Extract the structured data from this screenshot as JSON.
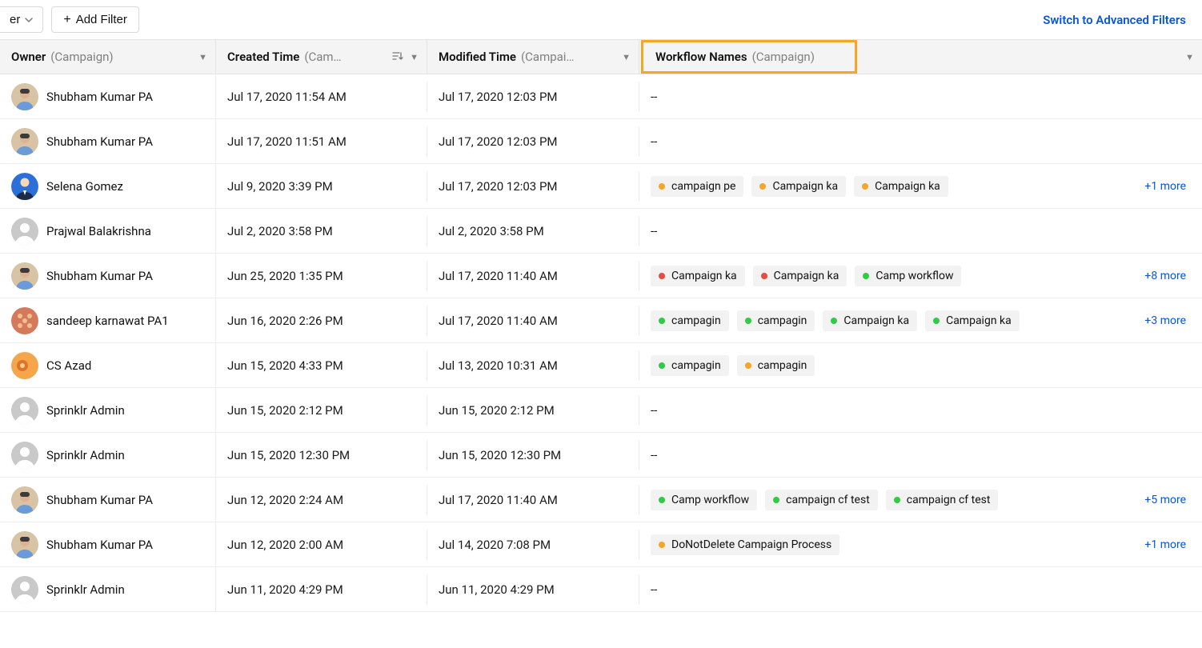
{
  "toolbar": {
    "dropdown_truncated": "er",
    "add_filter_label": "Add Filter",
    "switch_link": "Switch to Advanced Filters"
  },
  "columns": {
    "owner": {
      "main": "Owner",
      "sub": "(Campaign)"
    },
    "created": {
      "main": "Created Time",
      "sub": "(Cam…"
    },
    "modified": {
      "main": "Modified Time",
      "sub": "(Campai…"
    },
    "workflow": {
      "main": "Workflow Names",
      "sub": "(Campaign)"
    }
  },
  "avatar_types": {
    "photo1": "photo1",
    "suit": "suit",
    "default": "default",
    "pattern": "pattern",
    "orange": "orange"
  },
  "rows": [
    {
      "owner": "Shubham Kumar PA",
      "avatar": "photo1",
      "created": "Jul 17, 2020 11:54 AM",
      "modified": "Jul 17, 2020 12:03 PM",
      "workflow": null
    },
    {
      "owner": "Shubham Kumar PA",
      "avatar": "photo1",
      "created": "Jul 17, 2020 11:51 AM",
      "modified": "Jul 17, 2020 12:03 PM",
      "workflow": null
    },
    {
      "owner": "Selena Gomez",
      "avatar": "suit",
      "created": "Jul 9, 2020 3:39 PM",
      "modified": "Jul 17, 2020 12:03 PM",
      "workflow": {
        "tags": [
          {
            "color": "amber",
            "text": "campaign pe"
          },
          {
            "color": "amber",
            "text": "Campaign ka"
          },
          {
            "color": "amber",
            "text": "Campaign ka"
          }
        ],
        "more": "+1 more"
      }
    },
    {
      "owner": "Prajwal Balakrishna",
      "avatar": "default",
      "created": "Jul 2, 2020 3:58 PM",
      "modified": "Jul 2, 2020 3:58 PM",
      "workflow": null
    },
    {
      "owner": "Shubham Kumar PA",
      "avatar": "photo1",
      "created": "Jun 25, 2020 1:35 PM",
      "modified": "Jul 17, 2020 11:40 AM",
      "workflow": {
        "tags": [
          {
            "color": "red",
            "text": "Campaign ka"
          },
          {
            "color": "red",
            "text": "Campaign ka"
          },
          {
            "color": "green",
            "text": "Camp workflow"
          }
        ],
        "more": "+8 more"
      }
    },
    {
      "owner": "sandeep karnawat PA1",
      "avatar": "pattern",
      "created": "Jun 16, 2020 2:26 PM",
      "modified": "Jul 17, 2020 11:40 AM",
      "workflow": {
        "tags": [
          {
            "color": "green",
            "text": "campagin"
          },
          {
            "color": "green",
            "text": "campagin"
          },
          {
            "color": "green",
            "text": "Campaign ka"
          },
          {
            "color": "green",
            "text": "Campaign ka"
          }
        ],
        "more": "+3 more"
      }
    },
    {
      "owner": "CS Azad",
      "avatar": "orange",
      "created": "Jun 15, 2020 4:33 PM",
      "modified": "Jul 13, 2020 10:31 AM",
      "workflow": {
        "tags": [
          {
            "color": "green",
            "text": "campagin"
          },
          {
            "color": "amber",
            "text": "campagin"
          }
        ],
        "more": null
      }
    },
    {
      "owner": "Sprinklr Admin",
      "avatar": "default",
      "created": "Jun 15, 2020 2:12 PM",
      "modified": "Jun 15, 2020 2:12 PM",
      "workflow": null
    },
    {
      "owner": "Sprinklr Admin",
      "avatar": "default",
      "created": "Jun 15, 2020 12:30 PM",
      "modified": "Jun 15, 2020 12:30 PM",
      "workflow": null
    },
    {
      "owner": "Shubham Kumar PA",
      "avatar": "photo1",
      "created": "Jun 12, 2020 2:24 AM",
      "modified": "Jul 17, 2020 11:40 AM",
      "workflow": {
        "tags": [
          {
            "color": "green",
            "text": "Camp workflow"
          },
          {
            "color": "green",
            "text": "campaign cf test"
          },
          {
            "color": "green",
            "text": "campaign cf test"
          }
        ],
        "more": "+5 more"
      }
    },
    {
      "owner": "Shubham Kumar PA",
      "avatar": "photo1",
      "created": "Jun 12, 2020 2:00 AM",
      "modified": "Jul 14, 2020 7:08 PM",
      "workflow": {
        "tags": [
          {
            "color": "amber",
            "text": "DoNotDelete Campaign Process"
          }
        ],
        "more": "+1 more"
      }
    },
    {
      "owner": "Sprinklr Admin",
      "avatar": "default",
      "created": "Jun 11, 2020 4:29 PM",
      "modified": "Jun 11, 2020 4:29 PM",
      "workflow": null
    }
  ],
  "empty_placeholder": "--"
}
